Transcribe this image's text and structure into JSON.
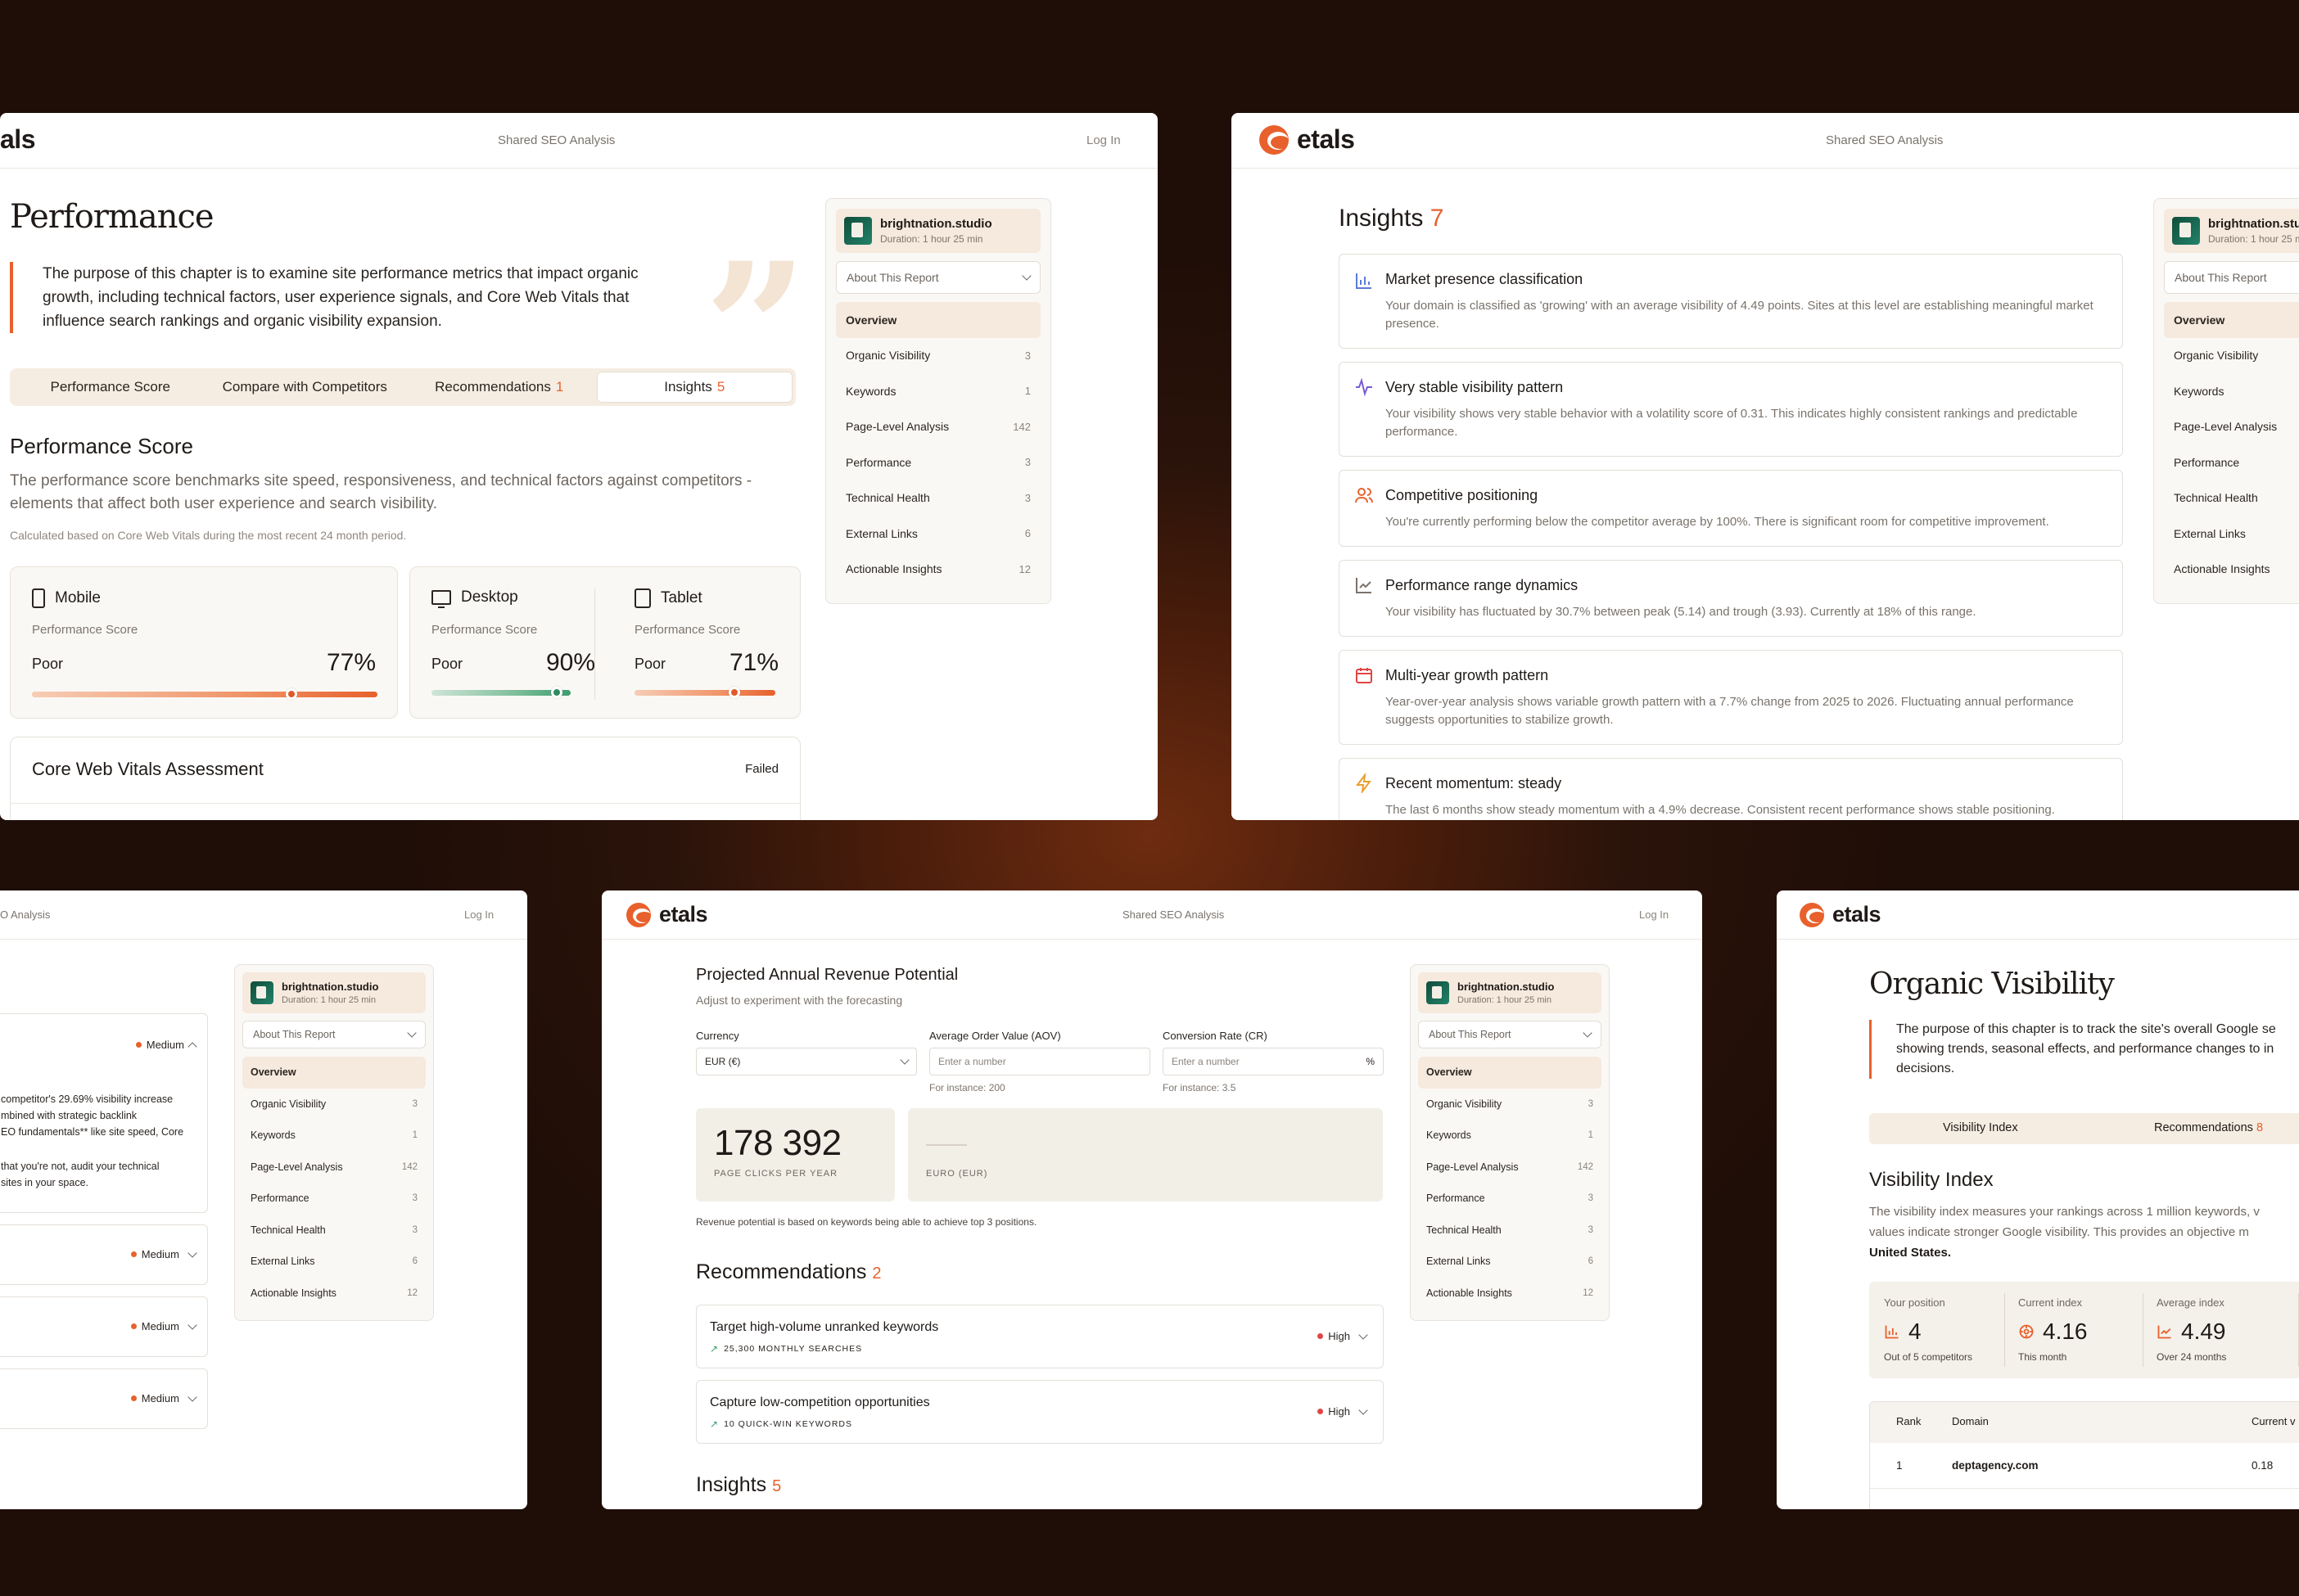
{
  "brand": {
    "name": "etals",
    "name_cropped": "als",
    "accent": "#e8612c"
  },
  "header": {
    "center": "Shared SEO Analysis",
    "center_cropped": "O Analysis",
    "login": "Log In"
  },
  "site": {
    "name": "brightnation.studio",
    "name_cropped": "brightnation.stud",
    "duration": "Duration: 1 hour 25 min",
    "duration_cropped": "Duration: 1 hour 25 m"
  },
  "nav": {
    "select_label": "About This Report",
    "items": [
      {
        "label": "Overview",
        "count": ""
      },
      {
        "label": "Organic Visibility",
        "count": "3"
      },
      {
        "label": "Keywords",
        "count": "1"
      },
      {
        "label": "Page-Level Analysis",
        "count": "142"
      },
      {
        "label": "Performance",
        "count": "3"
      },
      {
        "label": "Technical Health",
        "count": "3"
      },
      {
        "label": "External Links",
        "count": "6"
      },
      {
        "label": "Actionable Insights",
        "count": "12"
      }
    ]
  },
  "performance": {
    "title": "Performance",
    "intro": "The purpose of this chapter is to examine site performance metrics that impact organic growth, including technical factors, user experience signals, and Core Web Vitals that influence search rankings and organic visibility expansion.",
    "tabs": [
      {
        "label": "Performance Score",
        "count": ""
      },
      {
        "label": "Compare with Competitors",
        "count": ""
      },
      {
        "label": "Recommendations",
        "count": "1"
      },
      {
        "label": "Insights",
        "count": "5"
      }
    ],
    "score_title": "Performance Score",
    "score_desc": "The performance score benchmarks site speed, responsiveness, and technical factors against competitors - elements that affect both user experience and search visibility.",
    "score_note": "Calculated based on Core Web Vitals during the most recent 24 month period.",
    "devices": [
      {
        "name": "Mobile",
        "sub": "Performance Score",
        "rating": "Poor",
        "pct": "77%",
        "value": 0.77,
        "icon": "phone-icon"
      },
      {
        "name": "Desktop",
        "sub": "Performance Score",
        "rating": "Poor",
        "pct": "90%",
        "value": 0.9,
        "icon": "desktop-icon"
      },
      {
        "name": "Tablet",
        "sub": "Performance Score",
        "rating": "Poor",
        "pct": "71%",
        "value": 0.71,
        "icon": "tablet-icon"
      }
    ],
    "cwv_title": "Core Web Vitals Assessment",
    "cwv_status": "Failed"
  },
  "insights_win": {
    "title": "Insights",
    "count": "7",
    "items": [
      {
        "title": "Market presence classification",
        "desc": "Your domain is classified as 'growing' with an average visibility of 4.49 points. Sites at this level are establishing meaningful market presence.",
        "icon": "bar-chart-icon",
        "color": "#5b7bd5"
      },
      {
        "title": "Very stable visibility pattern",
        "desc": "Your visibility shows very stable behavior with a volatility score of 0.31. This indicates highly consistent rankings and predictable performance.",
        "icon": "pulse-icon",
        "color": "#7a5bd5"
      },
      {
        "title": "Competitive positioning",
        "desc": "You're currently performing below the competitor average by 100%. There is significant room for competitive improvement.",
        "icon": "users-icon",
        "color": "#e8612c"
      },
      {
        "title": "Performance range dynamics",
        "desc": "Your visibility has fluctuated by 30.7% between peak (5.14) and trough (3.93). Currently at 18% of this range.",
        "icon": "line-chart-icon",
        "color": "#7a736c"
      },
      {
        "title": "Multi-year growth pattern",
        "desc": "Year-over-year analysis shows variable growth pattern with a 7.7% change from 2025 to 2026. Fluctuating annual performance suggests opportunities to stabilize growth.",
        "icon": "calendar-icon",
        "color": "#e04545"
      },
      {
        "title": "Recent momentum: steady",
        "desc": "The last 6 months show steady momentum with a 4.9% decrease. Consistent recent performance shows stable positioning.",
        "icon": "bolt-icon",
        "color": "#e8a02c"
      }
    ]
  },
  "recs_win": {
    "text_line1": "competitor's 29.69% visibility increase",
    "text_line2": "mbined with strategic backlink",
    "text_line3": "EO fundamentals** like site speed, Core",
    "text_line4": "that you're not, audit your technical",
    "text_line5": "sites in your space.",
    "priority": "Medium"
  },
  "revenue": {
    "title": "Projected Annual Revenue Potential",
    "subtitle": "Adjust to experiment with the forecasting",
    "currency_label": "Currency",
    "currency_value": "EUR (€)",
    "aov_label": "Average Order Value (AOV)",
    "aov_placeholder": "Enter a number",
    "aov_hint": "For instance: 200",
    "cr_label": "Conversion Rate (CR)",
    "cr_placeholder": "Enter a number",
    "cr_unit": "%",
    "cr_hint": "For instance: 3.5",
    "clicks_value": "178 392",
    "clicks_label": "PAGE CLICKS PER YEAR",
    "euro_label": "EURO (EUR)",
    "note": "Revenue potential is based on keywords being able to achieve top 3 positions.",
    "recs_title": "Recommendations",
    "recs_count": "2",
    "recs": [
      {
        "title": "Target high-volume unranked keywords",
        "sub": "25,300 MONTHLY SEARCHES",
        "priority": "High"
      },
      {
        "title": "Capture low-competition opportunities",
        "sub": "10 QUICK-WIN KEYWORDS",
        "priority": "High"
      }
    ],
    "insights_title": "Insights",
    "insights_count": "5"
  },
  "visibility": {
    "title": "Organic Visibility",
    "intro_line1": "The purpose of this chapter is to track the site's overall Google se",
    "intro_line2": "showing trends, seasonal effects, and performance changes to in",
    "intro_line3": "decisions.",
    "tabs": [
      {
        "label": "Visibility Index",
        "count": ""
      },
      {
        "label": "Recommendations",
        "count": "8"
      }
    ],
    "index_title": "Visibility Index",
    "index_desc1": "The visibility index measures your rankings across 1 million keywords, v",
    "index_desc2": "values indicate stronger Google visibility. This provides an objective m",
    "index_desc3": "United States.",
    "kpis": [
      {
        "label": "Your position",
        "value": "4",
        "sub": "Out of 5 competitors",
        "icon": "bar-chart-icon"
      },
      {
        "label": "Current index",
        "value": "4.16",
        "sub": "This month",
        "icon": "target-icon"
      },
      {
        "label": "Average index",
        "value": "4.49",
        "sub": "Over 24 months",
        "icon": "line-chart-icon"
      }
    ],
    "table": {
      "headers": [
        "Rank",
        "Domain",
        "Current v"
      ],
      "rows": [
        {
          "rank": "1",
          "domain": "deptagency.com",
          "value": "0.18"
        }
      ]
    }
  }
}
